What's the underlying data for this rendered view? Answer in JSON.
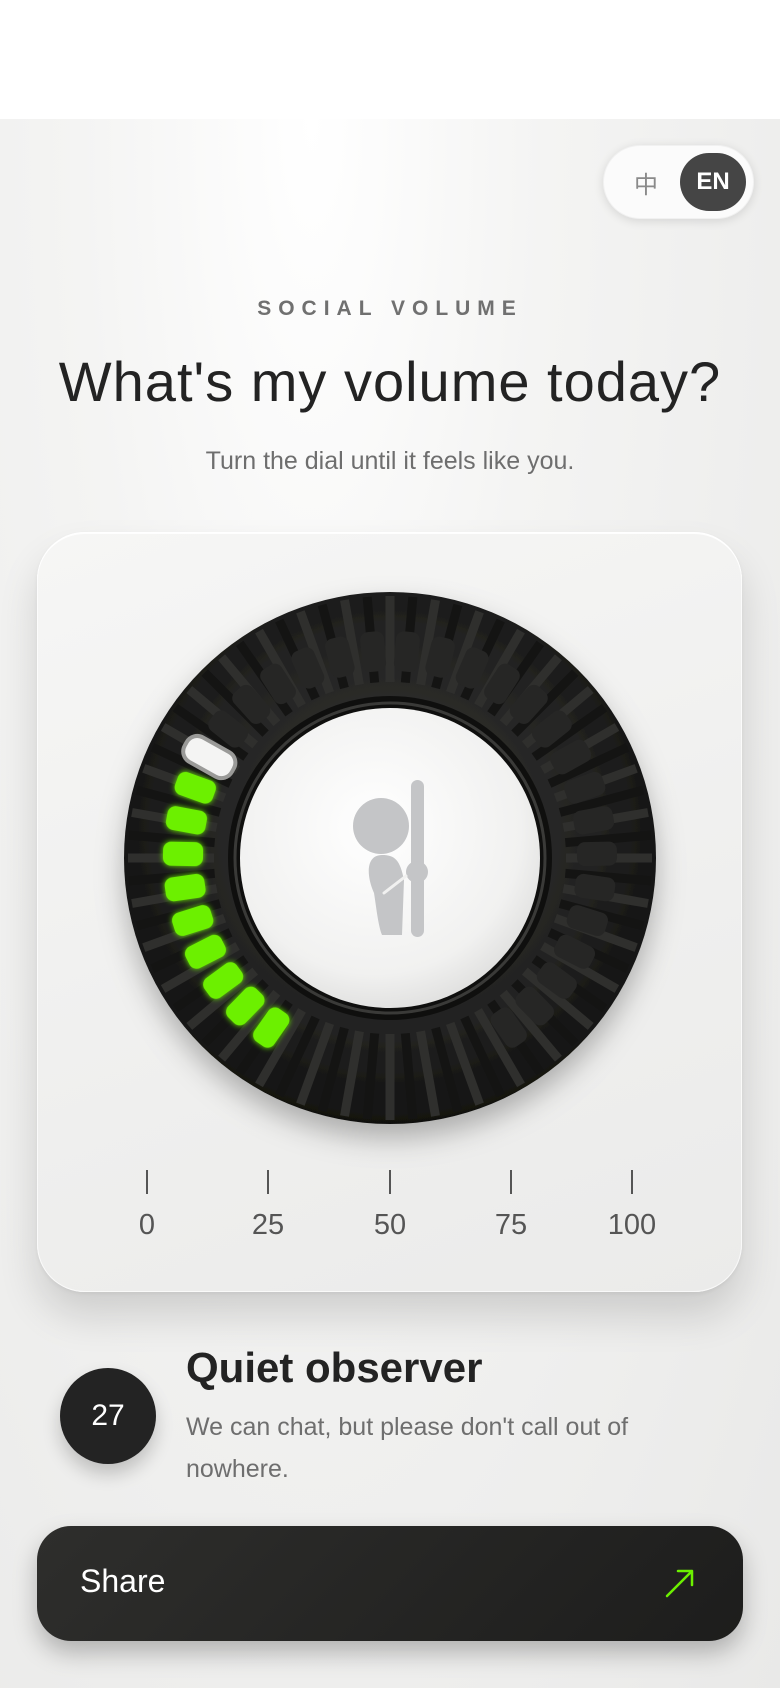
{
  "language_toggle": {
    "zh_label": "中",
    "en_label": "EN",
    "selected": "EN"
  },
  "header": {
    "eyebrow": "SOCIAL VOLUME",
    "title": "What's my volume today?",
    "subtitle": "Turn the dial until it feels like you."
  },
  "dial": {
    "value": 27,
    "min": 0,
    "max": 100,
    "active_color": "#6cf000",
    "knob_color": "#1c1c1b",
    "center_icon": "peeking-person-icon",
    "scale": [
      "0",
      "25",
      "50",
      "75",
      "100"
    ]
  },
  "result": {
    "value_label": "27",
    "title": "Quiet observer",
    "description": "We can chat, but please don't call out of nowhere."
  },
  "share": {
    "label": "Share",
    "icon": "arrow-up-right-icon",
    "icon_color": "#6cf000"
  }
}
